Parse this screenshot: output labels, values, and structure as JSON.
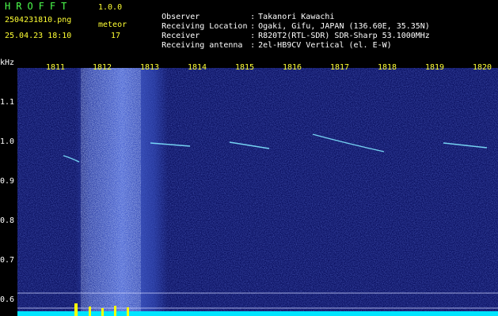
{
  "header": {
    "app_name": "HROFFT",
    "version": "1.0.0",
    "filename": "2504231810.png",
    "meteor_label": "meteor",
    "datetime": "25.04.23 18:10",
    "meteor_count": "17"
  },
  "info": [
    {
      "key": "Observer",
      "value": "Takanori Kawachi"
    },
    {
      "key": "Receiving Location",
      "value": "Ogaki, Gifu, JAPAN (136.60E, 35.35N)"
    },
    {
      "key": "Receiver",
      "value": "R820T2(RTL-SDR) SDR-Sharp 53.1000MHz"
    },
    {
      "key": "Receiving antenna",
      "value": "2el-HB9CV Vertical (el. E-W)"
    }
  ],
  "axis": {
    "y_unit": "kHz",
    "y_ticks": [
      "1.1",
      "1.0",
      "0.9",
      "0.8",
      "0.7",
      "0.6"
    ],
    "x_ticks": [
      "1811",
      "1812",
      "1813",
      "1814",
      "1815",
      "1816",
      "1817",
      "1818",
      "1819",
      "1820"
    ]
  },
  "colors": {
    "background": "#000000",
    "spectrogram_base": "#0a1060",
    "noise_band": "#9fb6ff",
    "trace": "#7fe6ff",
    "bottom_bar": "#00e5ff",
    "bottom_spike": "#ffff00"
  }
}
